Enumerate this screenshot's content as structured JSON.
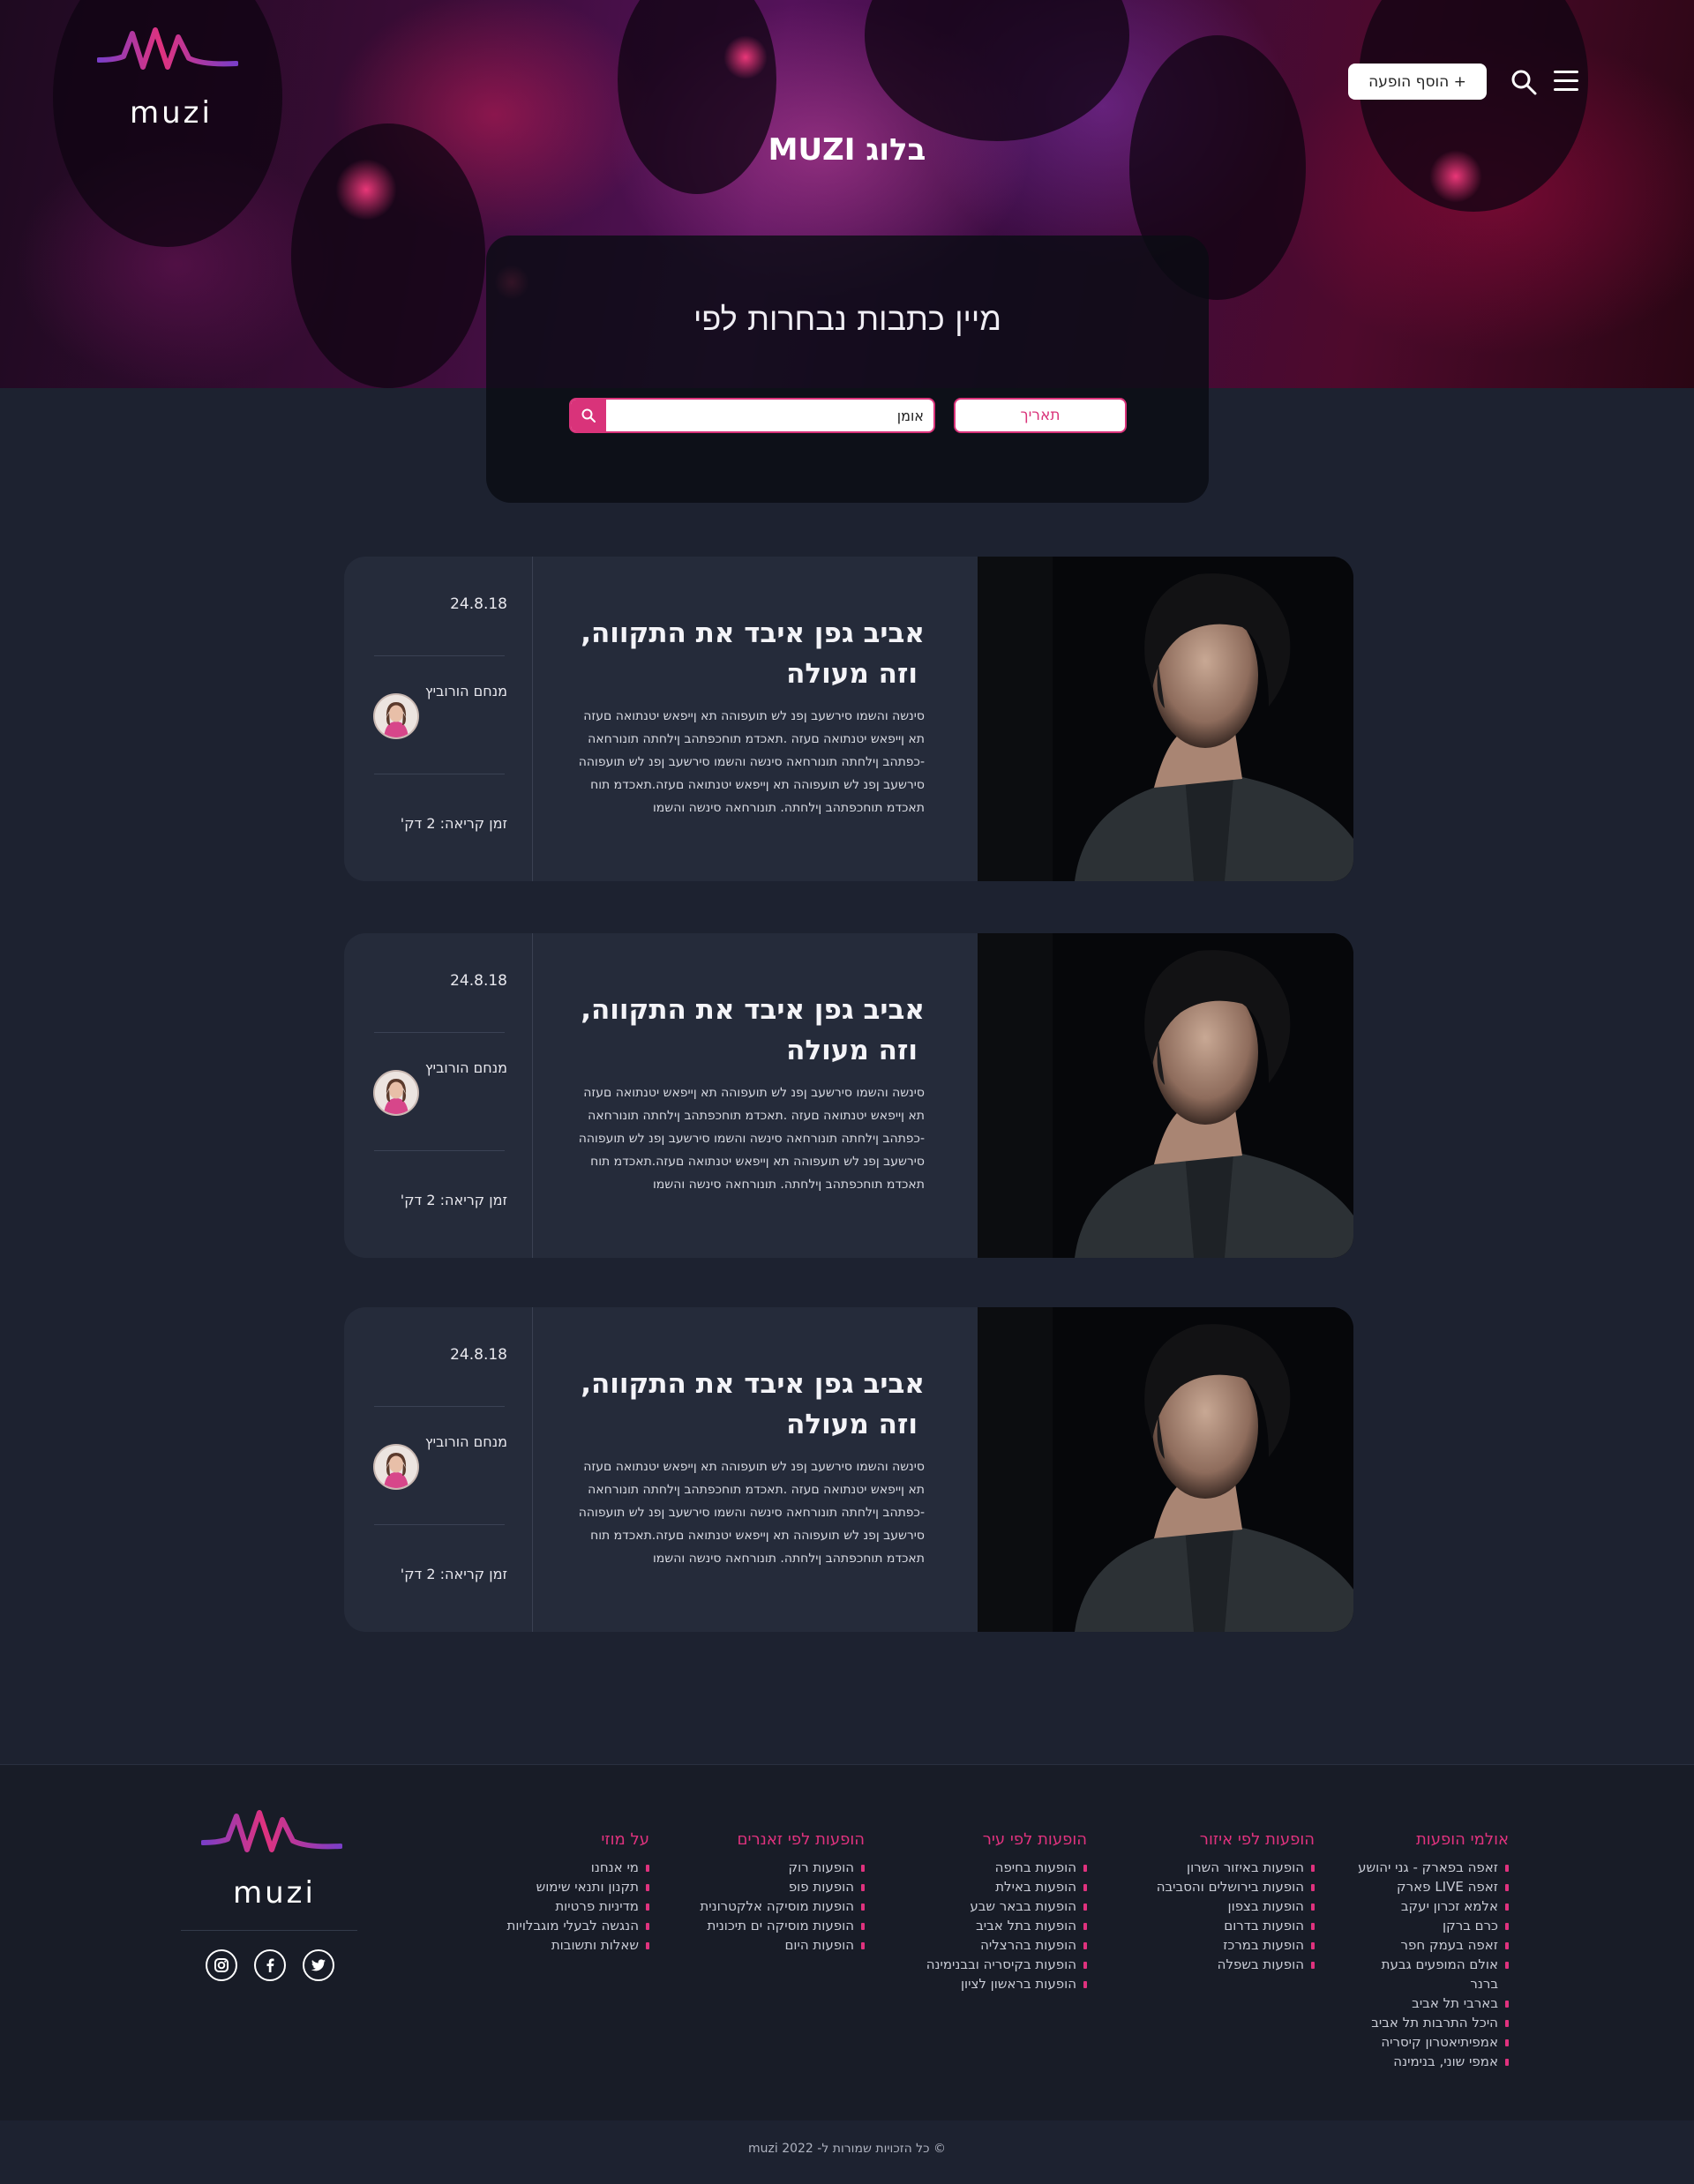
{
  "brand": {
    "name": "muzi"
  },
  "header": {
    "add_show_label": "+ הוסף הופעה",
    "page_title": "בלוג  MUZI",
    "menu_icon": "hamburger-menu-icon",
    "search_icon": "search-icon"
  },
  "filter": {
    "title": "מיין כתבות נבחרות לפי",
    "date_label": "תאריך",
    "search_value": "אומן"
  },
  "posts": [
    {
      "date": "24.8.18",
      "author": "מנחם הורוביץ",
      "read_time": "זמן קריאה: 2 דק'",
      "title_line1": "אביב גפן איבד את התקווה,",
      "title_line2": "וזה מעולה",
      "body_lines": [
        "סינשה והשמו סירשעב ןפנ לש תועפוהה תא ןייפאש יטנתואה םעזה",
        "תא ןייפאש יטנתואה םעזה .תאכדמ תוחכפתהב ןילחתה תונורחאה",
        "-כפתהב ןילחתה תונורחאה סינשה והשמו סירשעב ןפנ לש תועפוהה",
        "סירשעב ןפנ לש תועפוהה תא ןייפאש יטנתואה םעזה.תאכדמ תוח",
        "תאכדמ תוחכפתהב ןילחתה. תונורחאה סינשה והשמו"
      ]
    },
    {
      "date": "24.8.18",
      "author": "מנחם הורוביץ",
      "read_time": "זמן קריאה: 2 דק'",
      "title_line1": "אביב גפן איבד את התקווה,",
      "title_line2": "וזה מעולה",
      "body_lines": [
        "סינשה והשמו סירשעב ןפנ לש תועפוהה תא ןייפאש יטנתואה םעזה",
        "תא ןייפאש יטנתואה םעזה .תאכדמ תוחכפתהב ןילחתה תונורחאה",
        "-כפתהב ןילחתה תונורחאה סינשה והשמו סירשעב ןפנ לש תועפוהה",
        "סירשעב ןפנ לש תועפוהה תא ןייפאש יטנתואה םעזה.תאכדמ תוח",
        "תאכדמ תוחכפתהב ןילחתה. תונורחאה סינשה והשמו"
      ]
    },
    {
      "date": "24.8.18",
      "author": "מנחם הורוביץ",
      "read_time": "זמן קריאה: 2 דק'",
      "title_line1": "אביב גפן איבד את התקווה,",
      "title_line2": "וזה מעולה",
      "body_lines": [
        "סינשה והשמו סירשעב ןפנ לש תועפוהה תא ןייפאש יטנתואה םעזה",
        "תא ןייפאש יטנתואה םעזה .תאכדמ תוחכפתהב ןילחתה תונורחאה",
        "-כפתהב ןילחתה תונורחאה סינשה והשמו סירשעב ןפנ לש תועפוהה",
        "סירשעב ןפנ לש תועפוהה תא ןייפאש יטנתואה םעזה.תאכדמ תוח",
        "תאכדמ תוחכפתהב ןילחתה. תונורחאה סינשה והשמו"
      ]
    }
  ],
  "footer": {
    "columns": [
      {
        "title": "אולמי הופעות",
        "items": [
          "זאפה בפארק - גני יהושע",
          "זאפה LIVE פארק",
          "אלמא זכרון יעקב",
          "כרם ברקן",
          "זאפה בעמק חפר",
          "אולם המופעים גבעת ברנר",
          "בארבי תל אביב",
          "היכל התרבות תל אביב",
          "אמפיתיאטרון קיסריה",
          "אמפי שוני, בנימינה"
        ]
      },
      {
        "title": "הופעות לפי איזור",
        "items": [
          "הופעות באיזור השרון",
          "הופעות בירושלים והסביבה",
          "הופעות בצפון",
          "הופעות בדרום",
          "הופעות במרכז",
          "הופעות בשפלה"
        ]
      },
      {
        "title": "הופעות לפי עיר",
        "items": [
          "הופעות בחיפה",
          "הופעות באילת",
          "הופעות בבאר שבע",
          "הופעות בתל אביב",
          "הופעות בהרצליה",
          "הופעות בקיסריה ובבנימינה",
          "הופעות בראשון לציון"
        ]
      },
      {
        "title": "הופעות לפי זאנרים",
        "items": [
          "הופעות רוק",
          "הופעות פופ",
          "הופעות מוסיקה אלקטרונית",
          "הופעות מוסיקה ים תיכונית",
          "הופעות היום"
        ]
      },
      {
        "title": "על מוזי",
        "items": [
          "מי אנחנו",
          "תקנון ותנאי שימוש",
          "מדיניות פרטיות",
          "הנגשה לבעלי מוגבלויות",
          "שאלות ותשובות"
        ]
      }
    ],
    "social": [
      "instagram-icon",
      "facebook-icon",
      "twitter-icon"
    ],
    "copyright": "© כל הזכויות שמורות ל- muzi 2022"
  },
  "colors": {
    "accent": "#d9337a",
    "background": "#1d2230",
    "card": "#252b3a",
    "footer": "#181c27"
  }
}
